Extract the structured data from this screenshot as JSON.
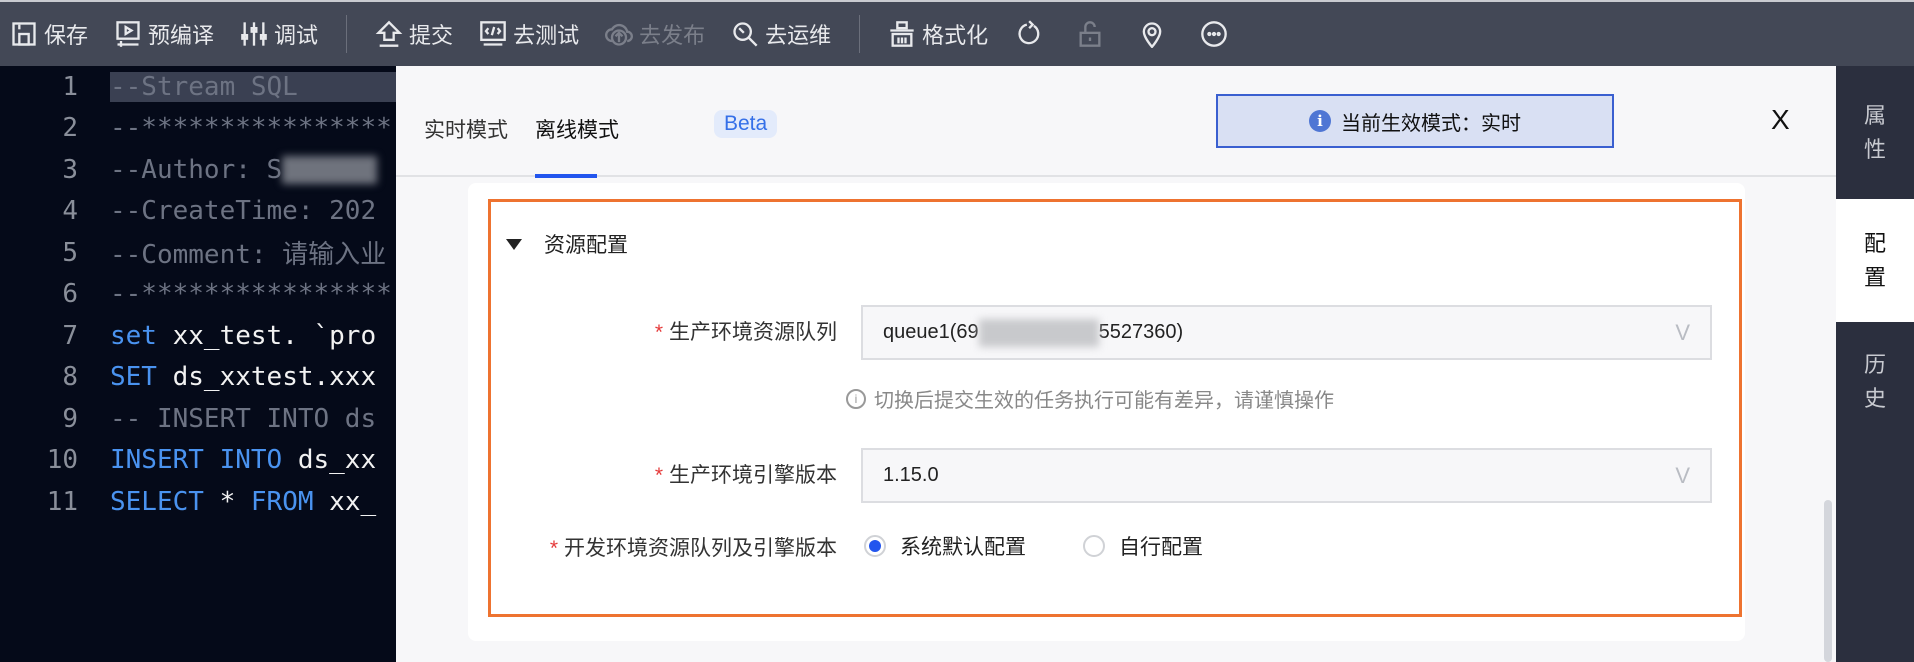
{
  "toolbar": {
    "save": "保存",
    "precompile": "预编译",
    "debug": "调试",
    "submit": "提交",
    "test": "去测试",
    "publish": "去发布",
    "ops": "去运维",
    "format": "格式化"
  },
  "editor": {
    "lines": [
      {
        "n": "1",
        "parts": [
          {
            "t": "--Stream SQL",
            "c": "cm"
          }
        ]
      },
      {
        "n": "2",
        "parts": [
          {
            "t": "--****************",
            "c": "cm"
          }
        ]
      },
      {
        "n": "3",
        "parts": [
          {
            "t": "--Author: S",
            "c": "cm"
          }
        ],
        "blur": true
      },
      {
        "n": "4",
        "parts": [
          {
            "t": "--CreateTime: 202",
            "c": "cm"
          }
        ]
      },
      {
        "n": "5",
        "parts": [
          {
            "t": "--Comment: 请输入业",
            "c": "cm"
          }
        ]
      },
      {
        "n": "6",
        "parts": [
          {
            "t": "--****************",
            "c": "cm"
          }
        ]
      },
      {
        "n": "7",
        "parts": [
          {
            "t": "set",
            "c": "kw"
          },
          {
            "t": " xx_test. `pro",
            "c": "id"
          }
        ]
      },
      {
        "n": "8",
        "parts": [
          {
            "t": "SET",
            "c": "kw"
          },
          {
            "t": " ds_xxtest.xxx",
            "c": "id"
          }
        ]
      },
      {
        "n": "9",
        "parts": [
          {
            "t": "-- INSERT INTO ds",
            "c": "cm"
          }
        ]
      },
      {
        "n": "10",
        "parts": [
          {
            "t": "INSERT INTO",
            "c": "kw"
          },
          {
            "t": " ds_xx",
            "c": "id"
          }
        ]
      },
      {
        "n": "11",
        "parts": [
          {
            "t": "SELECT",
            "c": "kw"
          },
          {
            "t": " * ",
            "c": "id"
          },
          {
            "t": "FROM",
            "c": "kw"
          },
          {
            "t": " xx_",
            "c": "id"
          }
        ]
      }
    ]
  },
  "panel": {
    "tabs": [
      "实时模式",
      "离线模式"
    ],
    "beta": "Beta",
    "info": "当前生效模式：实时",
    "close": "X",
    "section": "资源配置",
    "queue_label": "生产环境资源队列",
    "queue_value_start": "queue1(69",
    "queue_value_end": "5527360)",
    "hint": "切换后提交生效的任务执行可能有差异，请谨慎操作",
    "engine_label": "生产环境引擎版本",
    "engine_value": "1.15.0",
    "dev_label": "开发环境资源队列及引擎版本",
    "radio_default": "系统默认配置",
    "radio_custom": "自行配置",
    "required": "*",
    "chevron": "V"
  },
  "sidebar": {
    "tabs": [
      [
        "属",
        "性"
      ],
      [
        "配",
        "置"
      ],
      [
        "历",
        "史"
      ]
    ]
  },
  "colors": {
    "accent": "#2255ee",
    "highlight": "#ee7330",
    "toolbar": "#434856"
  }
}
